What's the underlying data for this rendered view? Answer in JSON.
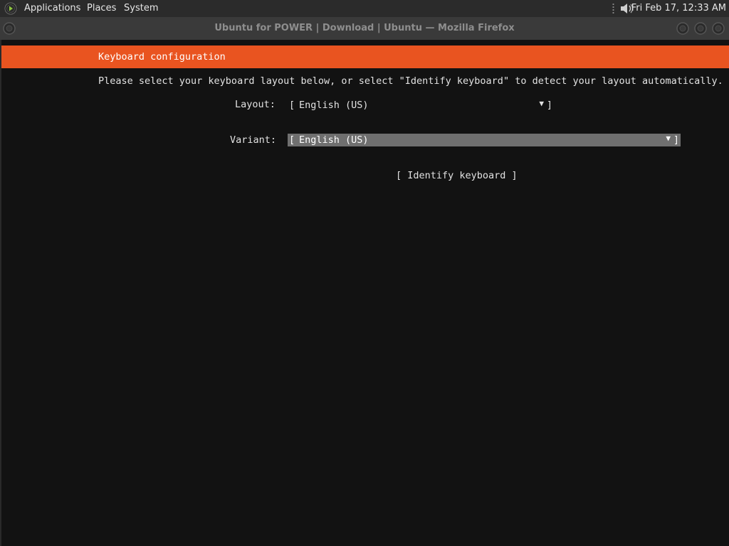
{
  "topbar": {
    "menus": [
      "Applications",
      "Places",
      "System"
    ],
    "clock": "Fri Feb 17, 12:33 AM"
  },
  "titlebar": {
    "title": "Ubuntu for POWER | Download | Ubuntu — Mozilla Firefox"
  },
  "installer": {
    "header": "Keyboard configuration",
    "instructions": "Please select your keyboard layout below, or select \"Identify keyboard\" to detect your layout automatically.",
    "layout": {
      "label": "Layout:",
      "value": "English (US)"
    },
    "variant": {
      "label": "Variant:",
      "value": "English (US)"
    },
    "identify_button": "[ Identify keyboard ]",
    "colors": {
      "accent": "#e95420",
      "background": "#121212",
      "selected_field": "#6f6f6f"
    }
  }
}
